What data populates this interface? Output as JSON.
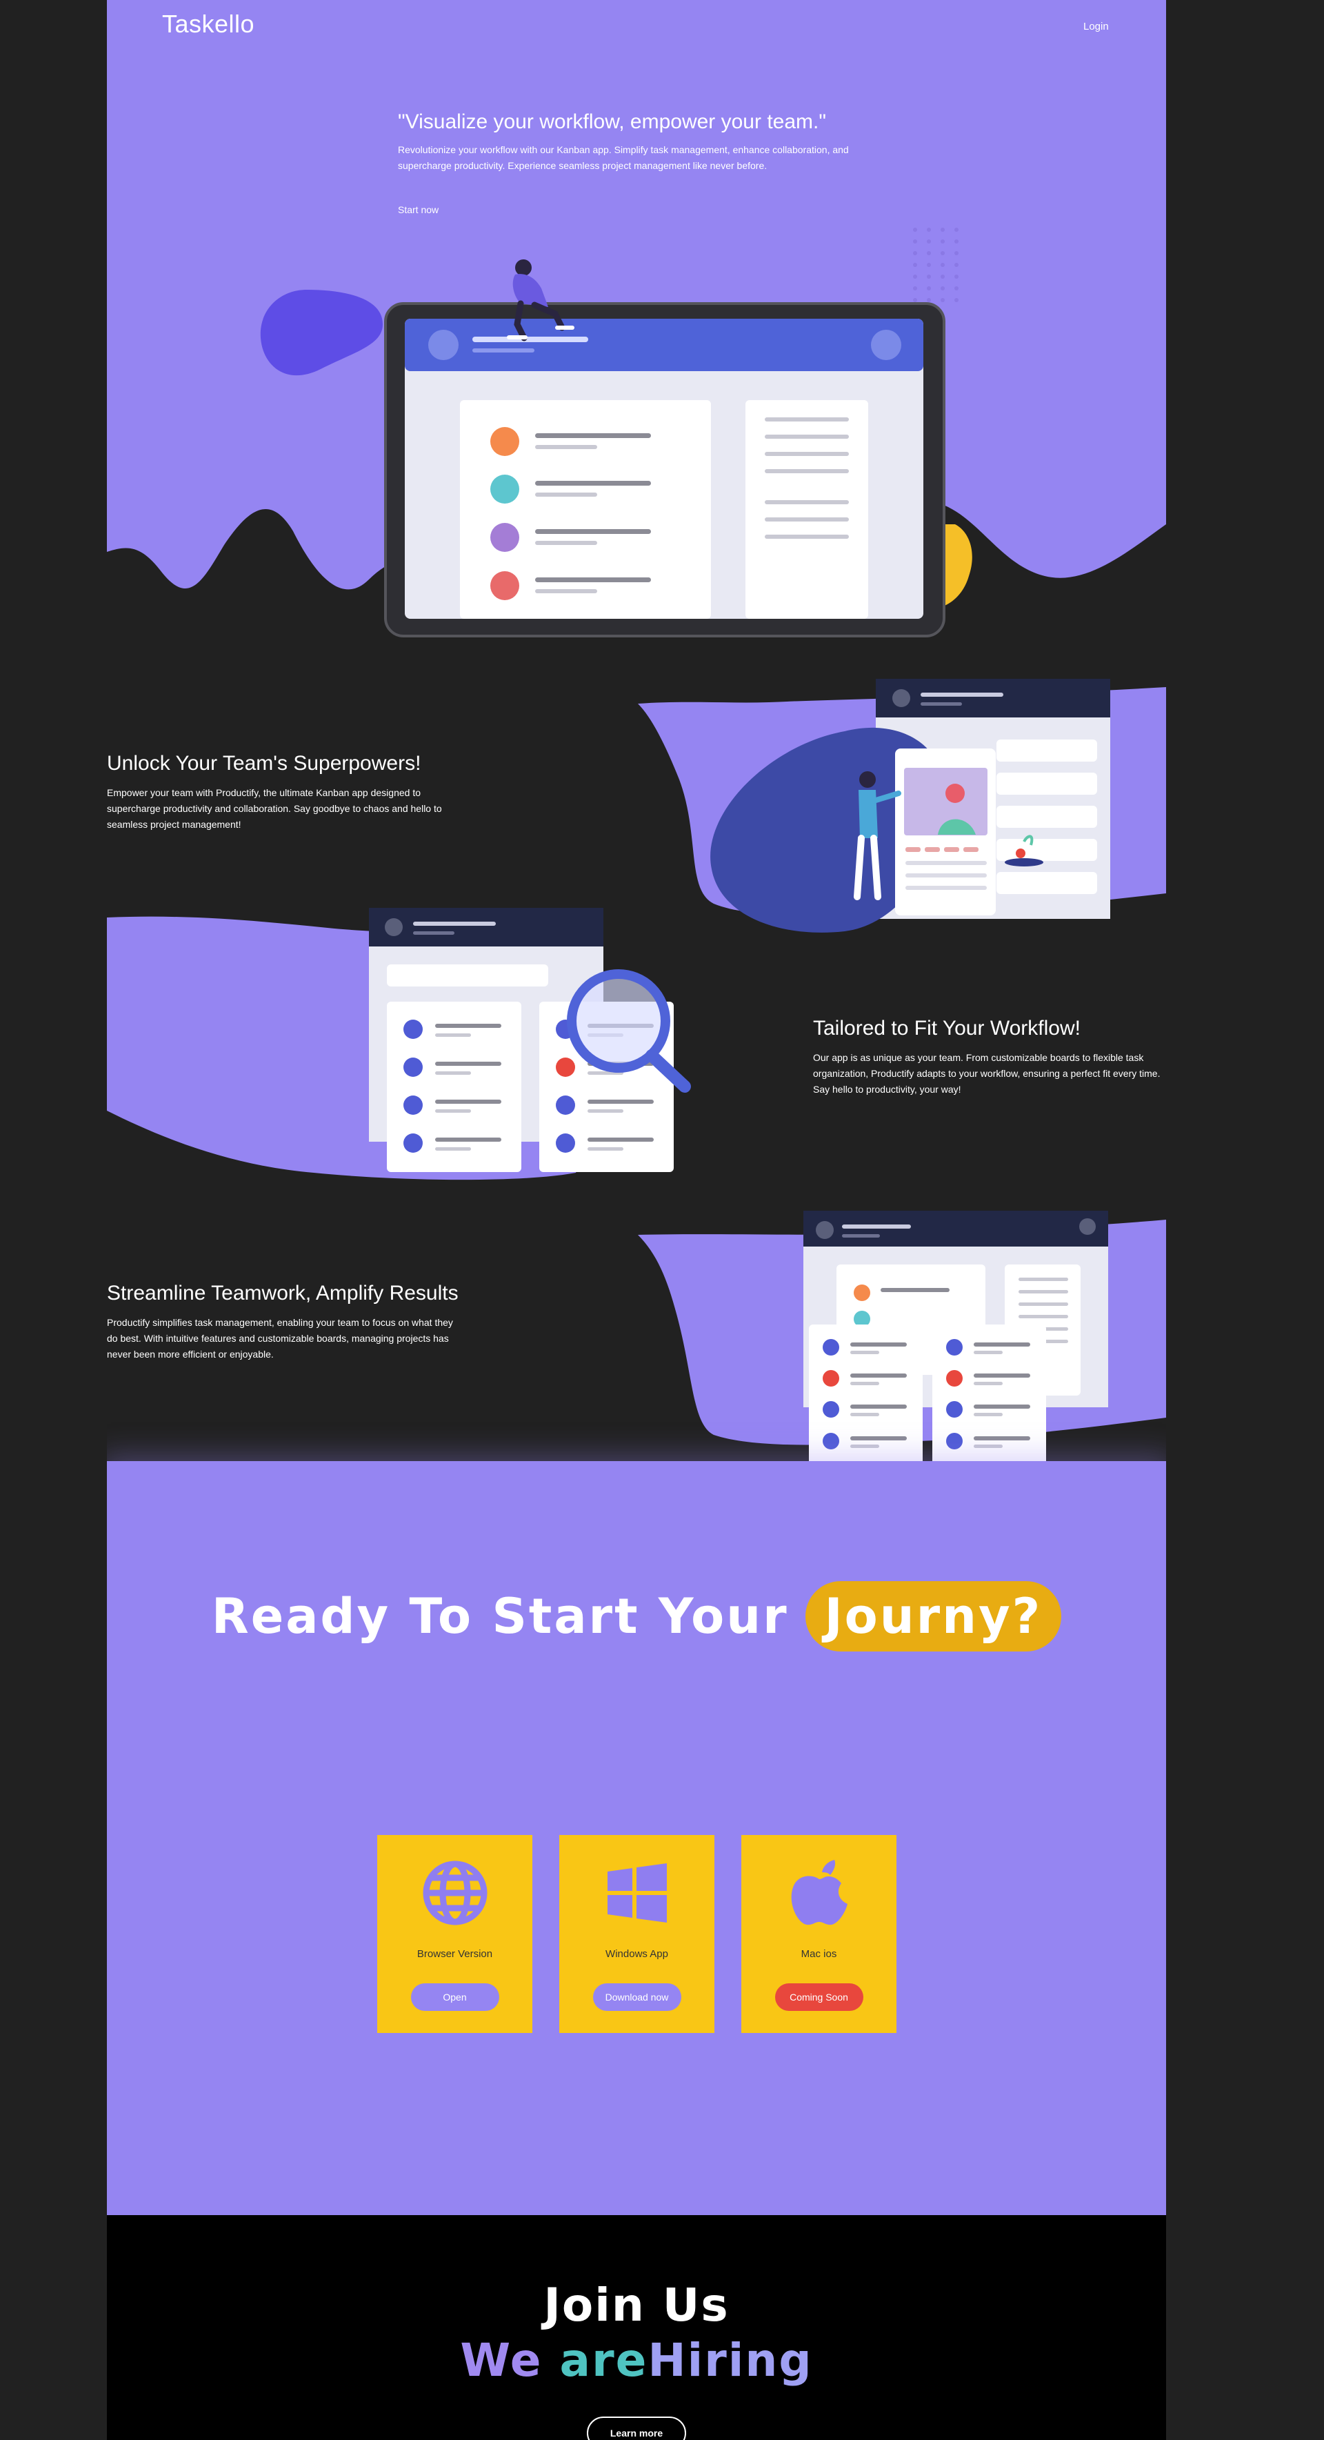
{
  "header": {
    "logo": "Taskello",
    "login": "Login"
  },
  "hero": {
    "title": "\"Visualize your workflow, empower your team.\"",
    "subtitle": "Revolutionize your workflow with our Kanban app. Simplify task management, enhance collaboration, and supercharge productivity. Experience seamless project management like never before.",
    "cta": "Start now"
  },
  "features": [
    {
      "title": "Unlock Your Team's Superpowers!",
      "text": "Empower your team with Productify, the ultimate Kanban app designed to supercharge productivity and collaboration. Say goodbye to chaos and hello to seamless project management!"
    },
    {
      "title": "Tailored to Fit Your Workflow!",
      "text": "Our app is as unique as your team. From customizable boards to flexible task organization, Productify adapts to your workflow, ensuring a perfect fit every time. Say hello to productivity, your way!"
    },
    {
      "title": "Streamline Teamwork, Amplify Results",
      "text": "Productify simplifies task management, enabling your team to focus on what they do best. With intuitive features and customizable boards, managing projects has never been more efficient or enjoyable."
    }
  ],
  "cta": {
    "title_main": "Ready To Start Your",
    "title_highlight": "Journy?",
    "cards": [
      {
        "name": "Browser Version",
        "button": "Open",
        "icon": "globe-icon"
      },
      {
        "name": "Windows App",
        "button": "Download now",
        "icon": "windows-icon"
      },
      {
        "name": "Mac ios",
        "button": "Coming Soon",
        "icon": "apple-icon"
      }
    ]
  },
  "join": {
    "title": "Join Us",
    "hiring_1": "We",
    "hiring_2": "are",
    "hiring_3": "Hiring",
    "button": "Learn more"
  },
  "colors": {
    "background": "#212121",
    "purple": "#9585f2",
    "yellow": "#f9c615",
    "accent_yellow": "#e8ac12",
    "blue": "#4f63d8",
    "red": "#e8473d",
    "navy": "#222846"
  }
}
